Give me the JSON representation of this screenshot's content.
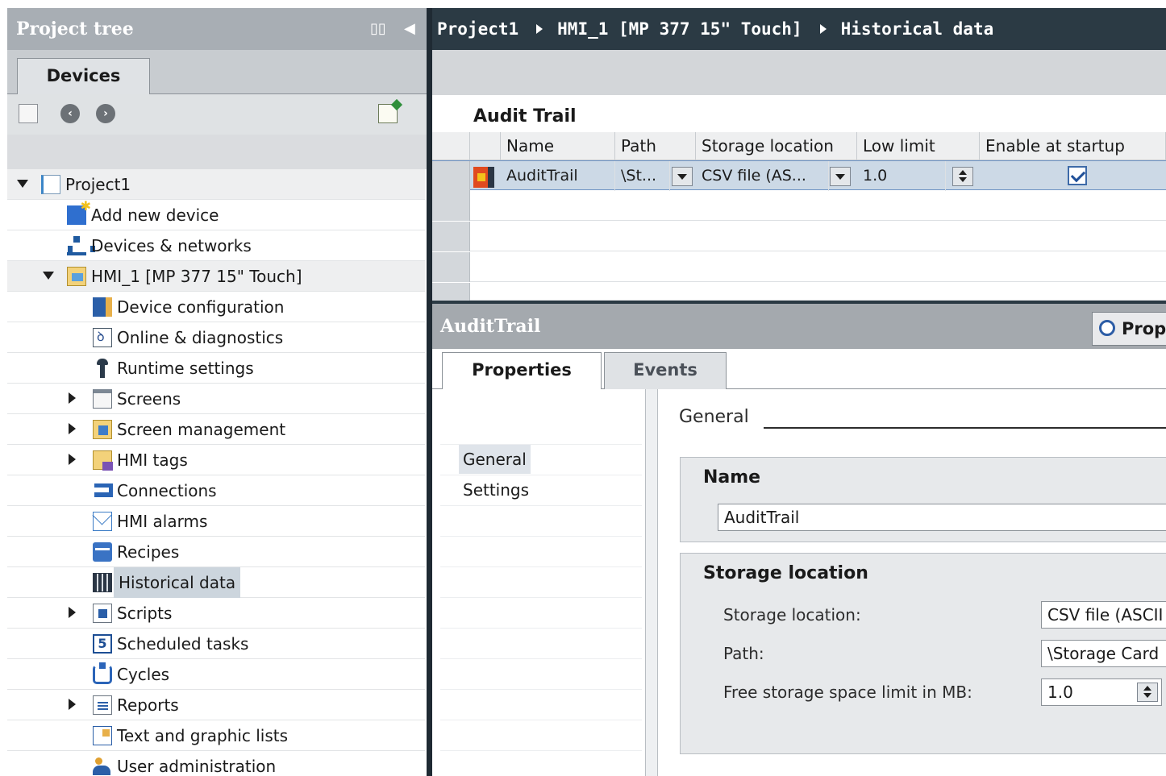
{
  "project_tree": {
    "title": "Project tree",
    "tab": "Devices",
    "items": [
      {
        "label": "Project1",
        "icon": "project-icon",
        "level": 0,
        "expander": "open"
      },
      {
        "label": "Add new device",
        "icon": "add-device-icon",
        "level": 1,
        "expander": "none"
      },
      {
        "label": "Devices & networks",
        "icon": "network-icon",
        "level": 1,
        "expander": "none"
      },
      {
        "label": "HMI_1 [MP 377 15\" Touch]",
        "icon": "hmi-device-icon",
        "level": 1,
        "expander": "open"
      },
      {
        "label": "Device configuration",
        "icon": "device-config-icon",
        "level": 2,
        "expander": "none"
      },
      {
        "label": "Online & diagnostics",
        "icon": "diagnostics-icon",
        "level": 2,
        "expander": "none"
      },
      {
        "label": "Runtime settings",
        "icon": "wrench-icon",
        "level": 2,
        "expander": "none"
      },
      {
        "label": "Screens",
        "icon": "folder-icon",
        "level": 2,
        "expander": "closed"
      },
      {
        "label": "Screen management",
        "icon": "screen-management-icon",
        "level": 2,
        "expander": "closed"
      },
      {
        "label": "HMI tags",
        "icon": "hmi-tags-icon",
        "level": 2,
        "expander": "closed"
      },
      {
        "label": "Connections",
        "icon": "connections-icon",
        "level": 2,
        "expander": "none"
      },
      {
        "label": "HMI alarms",
        "icon": "mail-icon",
        "level": 2,
        "expander": "none"
      },
      {
        "label": "Recipes",
        "icon": "recipe-icon",
        "level": 2,
        "expander": "none"
      },
      {
        "label": "Historical data",
        "icon": "historical-data-icon",
        "level": 2,
        "expander": "none",
        "selected": true
      },
      {
        "label": "Scripts",
        "icon": "scripts-icon",
        "level": 2,
        "expander": "closed"
      },
      {
        "label": "Scheduled tasks",
        "icon": "scheduled-tasks-icon",
        "level": 2,
        "expander": "none"
      },
      {
        "label": "Cycles",
        "icon": "cycle-icon",
        "level": 2,
        "expander": "none"
      },
      {
        "label": "Reports",
        "icon": "reports-icon",
        "level": 2,
        "expander": "closed"
      },
      {
        "label": "Text and graphic lists",
        "icon": "text-list-icon",
        "level": 2,
        "expander": "none"
      },
      {
        "label": "User administration",
        "icon": "user-admin-icon",
        "level": 2,
        "expander": "none"
      }
    ]
  },
  "breadcrumb": [
    "Project1",
    "HMI_1 [MP 377 15\" Touch]",
    "Historical data"
  ],
  "audit_table": {
    "caption": "Audit Trail",
    "columns": [
      "Name",
      "Path",
      "Storage location",
      "Low limit",
      "Enable at startup"
    ],
    "rows": [
      {
        "name": "AuditTrail",
        "path": "\\St...",
        "storage": "CSV file (AS...",
        "low_limit": "1.0",
        "enabled": true
      }
    ]
  },
  "properties": {
    "title": "AuditTrail",
    "right_tab": "Prop",
    "tabs": [
      "Properties",
      "Events"
    ],
    "nav": [
      "General",
      "Settings"
    ],
    "section_heading": "General",
    "name_group": {
      "title": "Name",
      "value": "AuditTrail"
    },
    "storage_group": {
      "title": "Storage location",
      "storage_label": "Storage location:",
      "storage_value": "CSV file (ASCII",
      "path_label": "Path:",
      "path_value": "\\Storage Card",
      "limit_label": "Free storage space limit in MB:",
      "limit_value": "1.0"
    }
  },
  "colors": {
    "title_bar_gray": "#a8aeb4",
    "breadcrumb_dark": "#2b3a44",
    "selection_blue": "#ccd9e6"
  }
}
